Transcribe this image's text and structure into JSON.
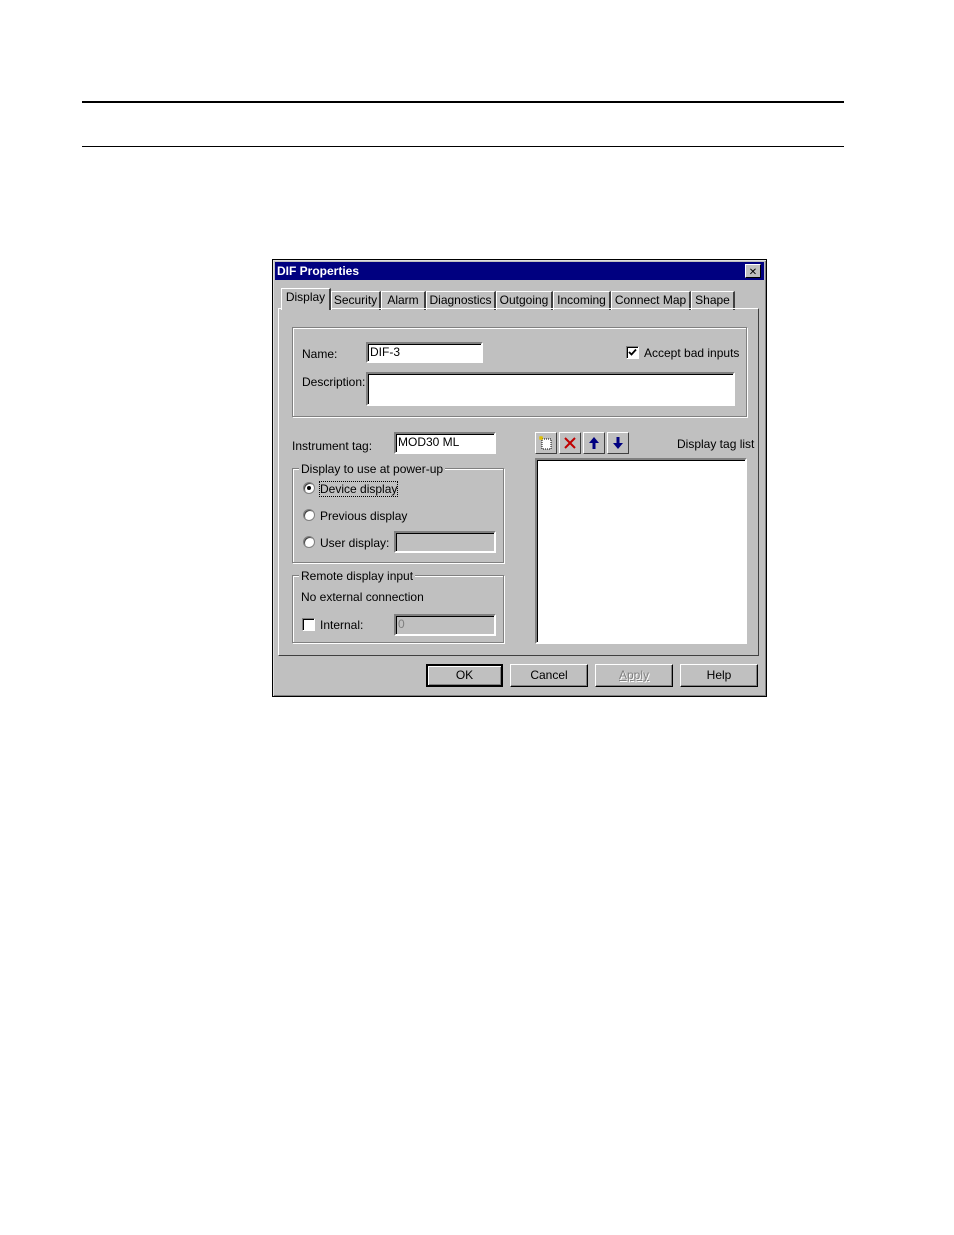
{
  "dialog": {
    "title": "DIF Properties",
    "close_glyph": "✕"
  },
  "tabs": [
    {
      "label": "Display",
      "active": true
    },
    {
      "label": "Security"
    },
    {
      "label": "Alarm"
    },
    {
      "label": "Diagnostics"
    },
    {
      "label": "Outgoing"
    },
    {
      "label": "Incoming"
    },
    {
      "label": "Connect Map"
    },
    {
      "label": "Shape"
    }
  ],
  "general": {
    "name_label": "Name:",
    "name_value": "DIF-3",
    "description_label": "Description:",
    "description_value": "",
    "accept_bad_inputs_label": "Accept bad inputs",
    "accept_bad_inputs_checked": true
  },
  "instrument": {
    "label": "Instrument tag:",
    "value": "MOD30 ML"
  },
  "powerup": {
    "title": "Display to use at power-up",
    "options": [
      {
        "label": "Device display",
        "selected": true
      },
      {
        "label": "Previous display",
        "selected": false
      },
      {
        "label": "User display:",
        "selected": false
      }
    ],
    "user_display_value": ""
  },
  "remote": {
    "title": "Remote display input",
    "status": "No external connection",
    "internal_label": "Internal:",
    "internal_checked": false,
    "internal_value": "0"
  },
  "tag_list": {
    "label": "Display tag list",
    "tools": [
      "new-item-icon",
      "delete-icon",
      "move-up-icon",
      "move-down-icon"
    ],
    "items": []
  },
  "buttons": {
    "ok": "OK",
    "cancel": "Cancel",
    "apply": "Apply",
    "help": "Help"
  },
  "colors": {
    "titlebar": "#000080",
    "face": "#c0c0c0",
    "delete_red": "#c00000",
    "arrow_blue": "#000080"
  }
}
